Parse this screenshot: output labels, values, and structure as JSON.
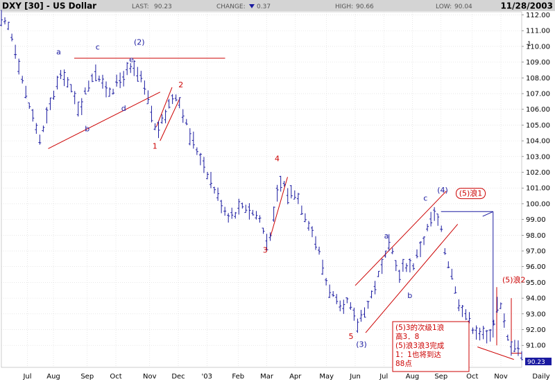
{
  "header": {
    "symbol": "DXY [30] - US Dollar",
    "last_label": "LAST:",
    "last_value": "90.23",
    "change_label": "CHANGE:",
    "change_value": "0.37",
    "change_direction": "down",
    "high_label": "HIGH:",
    "high_value": "90.66",
    "low_label": "LOW:",
    "low_value": "90.04",
    "date": "11/28/2003"
  },
  "colors": {
    "background": "#ffffff",
    "header_background": "#d4d4d4",
    "grid": "#d8d8d8",
    "price_bars": "#1a1aa0",
    "wave_label": "#cc0000",
    "wave_label_alt": "#1a1aa0",
    "annotation_border": "#cc0000",
    "last_price_tag": "#1a1aa0"
  },
  "chart_data": {
    "type": "ohlc",
    "title": "DXY [30] - US Dollar",
    "period": "Daily",
    "y_axis": {
      "position": "right",
      "range": [
        89.6,
        112.2
      ],
      "ticks": [
        91,
        92,
        93,
        94,
        95,
        96,
        97,
        98,
        99,
        100,
        101,
        102,
        103,
        104,
        105,
        106,
        107,
        108,
        109,
        110,
        111,
        112
      ],
      "tick_labels": [
        "91.00",
        "92.00",
        "93.00",
        "94.00",
        "95.00",
        "96.00",
        "97.00",
        "98.00",
        "99.00",
        "100.00",
        "101.00",
        "102.00",
        "103.00",
        "104.00",
        "105.00",
        "106.00",
        "107.00",
        "108.00",
        "109.00",
        "110.00",
        "111.00",
        "112.00"
      ]
    },
    "x_axis": {
      "labels": [
        "Jul",
        "Aug",
        "Sep",
        "Oct",
        "Nov",
        "Dec",
        "'03",
        "Feb",
        "Mar",
        "Apr",
        "May",
        "Jun",
        "Jul",
        "Aug",
        "Sep",
        "Oct",
        "Nov",
        "Daily"
      ],
      "label_t": [
        0.05,
        0.1,
        0.165,
        0.22,
        0.285,
        0.34,
        0.395,
        0.455,
        0.51,
        0.565,
        0.625,
        0.68,
        0.735,
        0.79,
        0.845,
        0.905,
        0.96,
        1.045
      ]
    },
    "price_path": [
      [
        0.0,
        111.6
      ],
      [
        0.015,
        111.2
      ],
      [
        0.03,
        109.5
      ],
      [
        0.045,
        107.2
      ],
      [
        0.06,
        105.6
      ],
      [
        0.075,
        104.0
      ],
      [
        0.09,
        105.8
      ],
      [
        0.105,
        107.5
      ],
      [
        0.12,
        108.3
      ],
      [
        0.135,
        107.1
      ],
      [
        0.15,
        106.0
      ],
      [
        0.165,
        107.4
      ],
      [
        0.18,
        108.6
      ],
      [
        0.195,
        107.5
      ],
      [
        0.21,
        107.2
      ],
      [
        0.225,
        107.7
      ],
      [
        0.24,
        108.4
      ],
      [
        0.255,
        108.5
      ],
      [
        0.27,
        107.8
      ],
      [
        0.283,
        106.5
      ],
      [
        0.297,
        104.6
      ],
      [
        0.31,
        105.2
      ],
      [
        0.325,
        106.6
      ],
      [
        0.335,
        107.0
      ],
      [
        0.345,
        106.3
      ],
      [
        0.36,
        104.5
      ],
      [
        0.375,
        103.5
      ],
      [
        0.39,
        102.5
      ],
      [
        0.405,
        101.3
      ],
      [
        0.42,
        100.2
      ],
      [
        0.435,
        99.3
      ],
      [
        0.45,
        99.5
      ],
      [
        0.465,
        100.0
      ],
      [
        0.48,
        99.5
      ],
      [
        0.495,
        99.2
      ],
      [
        0.51,
        97.6
      ],
      [
        0.52,
        98.4
      ],
      [
        0.53,
        100.5
      ],
      [
        0.54,
        101.6
      ],
      [
        0.55,
        100.6
      ],
      [
        0.565,
        100.8
      ],
      [
        0.58,
        99.6
      ],
      [
        0.595,
        98.5
      ],
      [
        0.61,
        97.0
      ],
      [
        0.625,
        95.0
      ],
      [
        0.64,
        94.0
      ],
      [
        0.655,
        93.0
      ],
      [
        0.665,
        93.8
      ],
      [
        0.675,
        93.0
      ],
      [
        0.685,
        92.3
      ],
      [
        0.695,
        93.2
      ],
      [
        0.705,
        93.6
      ],
      [
        0.72,
        95.0
      ],
      [
        0.735,
        96.2
      ],
      [
        0.745,
        97.3
      ],
      [
        0.755,
        96.8
      ],
      [
        0.765,
        95.3
      ],
      [
        0.775,
        96.2
      ],
      [
        0.79,
        96.0
      ],
      [
        0.805,
        97.2
      ],
      [
        0.815,
        98.0
      ],
      [
        0.825,
        99.0
      ],
      [
        0.835,
        99.3
      ],
      [
        0.845,
        98.3
      ],
      [
        0.855,
        96.6
      ],
      [
        0.865,
        95.8
      ],
      [
        0.875,
        94.0
      ],
      [
        0.89,
        93.2
      ],
      [
        0.905,
        92.2
      ],
      [
        0.92,
        91.8
      ],
      [
        0.935,
        91.4
      ],
      [
        0.945,
        92.4
      ],
      [
        0.955,
        93.8
      ],
      [
        0.962,
        93.2
      ],
      [
        0.972,
        91.5
      ],
      [
        0.98,
        91.0
      ],
      [
        0.99,
        91.2
      ],
      [
        1.0,
        90.23
      ]
    ],
    "bar_count": 150,
    "last_price": "90.23",
    "top_marker": "1",
    "grid": true,
    "trendlines": [
      {
        "color": "#cc0000",
        "points": [
          [
            0.14,
            109.25
          ],
          [
            0.43,
            109.25
          ]
        ]
      },
      {
        "color": "#cc0000",
        "points": [
          [
            0.09,
            103.5
          ],
          [
            0.305,
            107.1
          ]
        ]
      },
      {
        "color": "#cc0000",
        "points": [
          [
            0.298,
            104.9
          ],
          [
            0.328,
            107.4
          ]
        ]
      },
      {
        "color": "#cc0000",
        "points": [
          [
            0.305,
            104.0
          ],
          [
            0.343,
            106.7
          ]
        ]
      },
      {
        "color": "#cc0000",
        "points": [
          [
            0.517,
            97.9
          ],
          [
            0.55,
            101.7
          ]
        ]
      },
      {
        "color": "#cc0000",
        "points": [
          [
            0.68,
            94.8
          ],
          [
            0.855,
            100.8
          ]
        ]
      },
      {
        "color": "#cc0000",
        "points": [
          [
            0.7,
            91.8
          ],
          [
            0.877,
            98.7
          ]
        ]
      },
      {
        "color": "#1a1aa0",
        "points": [
          [
            0.845,
            99.5
          ],
          [
            0.945,
            99.5
          ]
        ]
      },
      {
        "color": "#1a1aa0",
        "points": [
          [
            0.945,
            99.5
          ],
          [
            0.945,
            91.5
          ]
        ]
      },
      {
        "color": "#1a1aa0",
        "points": [
          [
            0.945,
            99.5
          ],
          [
            0.925,
            99.2
          ]
        ]
      },
      {
        "color": "#cc0000",
        "points": [
          [
            0.952,
            94.7
          ],
          [
            0.952,
            91.0
          ]
        ]
      },
      {
        "color": "#cc0000",
        "points": [
          [
            0.98,
            94.0
          ],
          [
            0.98,
            90.5
          ]
        ]
      },
      {
        "color": "#cc0000",
        "points": [
          [
            0.98,
            90.5
          ],
          [
            1.0,
            90.5
          ]
        ]
      },
      {
        "color": "#cc0000",
        "points": [
          [
            0.915,
            90.9
          ],
          [
            0.985,
            90.1
          ]
        ]
      }
    ],
    "wave_labels": [
      {
        "text": "a",
        "x": 0.11,
        "y": 109.5,
        "color": "#1a1aa0"
      },
      {
        "text": "b",
        "x": 0.165,
        "y": 104.6,
        "color": "#1a1aa0"
      },
      {
        "text": "c",
        "x": 0.185,
        "y": 109.8,
        "color": "#1a1aa0"
      },
      {
        "text": "d",
        "x": 0.235,
        "y": 105.9,
        "color": "#1a1aa0"
      },
      {
        "text": "e",
        "x": 0.25,
        "y": 109.0,
        "color": "#1a1aa0"
      },
      {
        "text": "(2)",
        "x": 0.265,
        "y": 110.1,
        "color": "#1a1aa0"
      },
      {
        "text": "1",
        "x": 0.295,
        "y": 103.5,
        "color": "#cc0000"
      },
      {
        "text": "2",
        "x": 0.345,
        "y": 107.4,
        "color": "#cc0000"
      },
      {
        "text": "3",
        "x": 0.507,
        "y": 96.9,
        "color": "#cc0000"
      },
      {
        "text": "4",
        "x": 0.53,
        "y": 102.7,
        "color": "#cc0000"
      },
      {
        "text": "5",
        "x": 0.672,
        "y": 91.4,
        "color": "#cc0000"
      },
      {
        "text": "(3)",
        "x": 0.692,
        "y": 90.9,
        "color": "#1a1aa0"
      },
      {
        "text": "a",
        "x": 0.74,
        "y": 97.8,
        "color": "#1a1aa0"
      },
      {
        "text": "b",
        "x": 0.785,
        "y": 94.0,
        "color": "#1a1aa0"
      },
      {
        "text": "c",
        "x": 0.815,
        "y": 100.2,
        "color": "#1a1aa0"
      },
      {
        "text": "(4)",
        "x": 0.848,
        "y": 100.7,
        "color": "#1a1aa0"
      },
      {
        "text": "(5)浪1",
        "x": 0.902,
        "y": 100.5,
        "color": "#cc0000",
        "boxed": true
      },
      {
        "text": "(5)浪2",
        "x": 0.985,
        "y": 95.0,
        "color": "#cc0000"
      }
    ],
    "callout_lines": [
      "(5)3的次级1浪",
      "高3．8",
      "(5)浪3浪3完成",
      "1：1也将到达",
      "88点"
    ]
  }
}
